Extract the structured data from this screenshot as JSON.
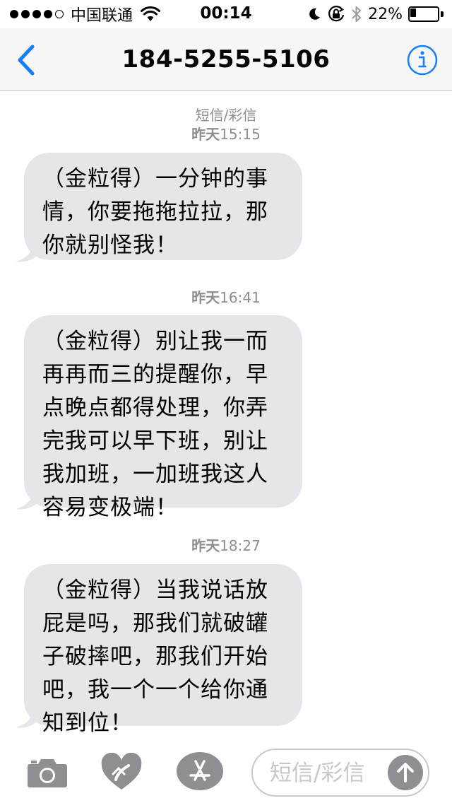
{
  "status_bar": {
    "carrier": "中国联通",
    "time": "00:14",
    "battery_percent_label": "22%",
    "battery_level": 0.22,
    "signal_bars_filled": 4,
    "signal_bars_total": 5
  },
  "nav": {
    "title": "184-5255-5106",
    "accent_color": "#147efb"
  },
  "thread": {
    "service_label": "短信/彩信",
    "messages": [
      {
        "day": "昨天",
        "time": "15:15",
        "text": "（金粒得）一分钟的事情，你要拖拖拉拉，那你就别怪我！"
      },
      {
        "day": "昨天",
        "time": "16:41",
        "text": "（金粒得）别让我一而再再而三的提醒你，早点晚点都得处理，你弄完我可以早下班，别让我加班，一加班我这人容易变极端！"
      },
      {
        "day": "昨天",
        "time": "18:27",
        "text": "（金粒得）当我说话放屁是吗，那我们就破罐子破摔吧，那我们开始吧，我一个一个给你通知到位！"
      }
    ],
    "bubble_color": "#e5e5ea"
  },
  "composer": {
    "placeholder": "短信/彩信",
    "icons": [
      "camera-icon",
      "digital-touch-heart-icon",
      "app-store-icon",
      "send-arrow-icon"
    ]
  }
}
